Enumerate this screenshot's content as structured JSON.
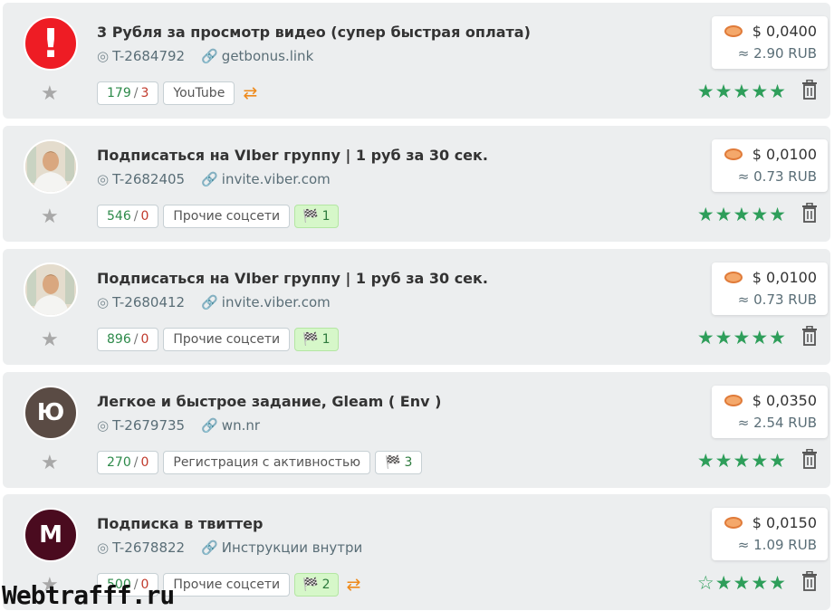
{
  "tasks": [
    {
      "avatar_text": "!",
      "avatar_kind": "red",
      "title": "3 Рубля за просмотр видео (супер быстрая оплата)",
      "id": "T-2684792",
      "link": "getbonus.link",
      "count_done": "179",
      "count_fail": "3",
      "category": "YouTube",
      "flags": "",
      "repeat": true,
      "usd": "$ 0,0400",
      "rub": "≈ 2.90 RUB",
      "rating": 5
    },
    {
      "avatar_text": "",
      "avatar_kind": "photo",
      "title": "Подписаться на VIber группу | 1 руб за 30 сек.",
      "id": "T-2682405",
      "link": "invite.viber.com",
      "count_done": "546",
      "count_fail": "0",
      "category": "Прочие соцсети",
      "flags": "1",
      "repeat": false,
      "usd": "$ 0,0100",
      "rub": "≈ 0.73 RUB",
      "rating": 5
    },
    {
      "avatar_text": "",
      "avatar_kind": "photo",
      "title": "Подписаться на VIber группу | 1 руб за 30 сек.",
      "id": "T-2680412",
      "link": "invite.viber.com",
      "count_done": "896",
      "count_fail": "0",
      "category": "Прочие соцсети",
      "flags": "1",
      "repeat": false,
      "usd": "$ 0,0100",
      "rub": "≈ 0.73 RUB",
      "rating": 5
    },
    {
      "avatar_text": "Ю",
      "avatar_kind": "brown",
      "title": "Легкое и быстрое задание, Gleam ( Env )",
      "id": "T-2679735",
      "link": "wn.nr",
      "count_done": "270",
      "count_fail": "0",
      "category": "Регистрация с активностью",
      "flags": "3",
      "repeat": false,
      "usd": "$ 0,0350",
      "rub": "≈ 2.54 RUB",
      "rating": 5
    },
    {
      "avatar_text": "M",
      "avatar_kind": "wine",
      "title": "Подписка в твиттер",
      "id": "T-2678822",
      "link": "Инструкции внутри",
      "count_done": "500",
      "count_fail": "0",
      "category": "Прочие соцсети",
      "flags": "2",
      "repeat": true,
      "usd": "$ 0,0150",
      "rub": "≈ 1.09 RUB",
      "rating": 4
    }
  ],
  "icons": {
    "favorite": "star-icon",
    "id": "target-icon",
    "link": "link-icon",
    "flag": "checkered-flag-icon",
    "repeat": "repeat-icon",
    "delete": "trash-icon",
    "coin": "coin-icon"
  },
  "colors": {
    "rating_green": "#2e9e5a",
    "repeat_orange": "#ee8a1b",
    "flag_bg": "#d6f7c9",
    "card_bg": "#eceeef"
  },
  "watermark": "Webtrafff.ru"
}
